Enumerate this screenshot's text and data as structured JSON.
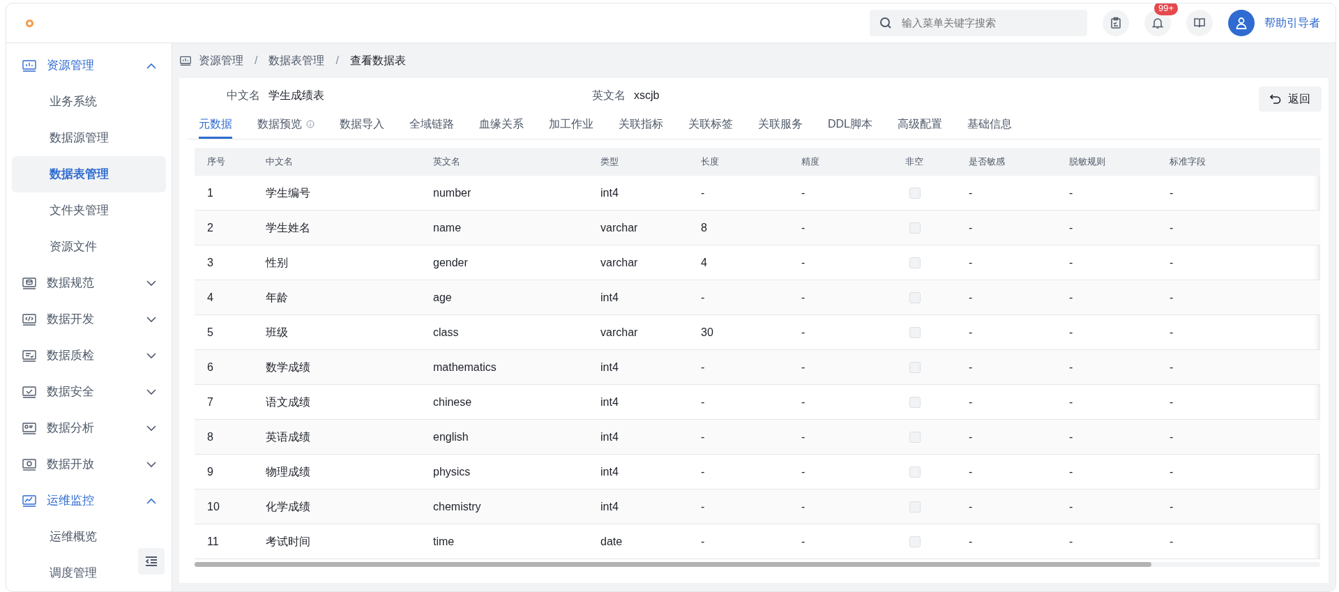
{
  "header": {
    "search": {
      "placeholder": "输入菜单关键字搜索"
    },
    "notification_badge": "99+",
    "user": "帮助引导者"
  },
  "sidebar": {
    "items": [
      {
        "label": "资源管理",
        "expanded": true,
        "children": [
          {
            "label": "业务系统",
            "selected": false
          },
          {
            "label": "数据源管理",
            "selected": false
          },
          {
            "label": "数据表管理",
            "selected": true
          },
          {
            "label": "文件夹管理",
            "selected": false
          },
          {
            "label": "资源文件",
            "selected": false
          }
        ]
      },
      {
        "label": "数据规范",
        "expanded": false
      },
      {
        "label": "数据开发",
        "expanded": false
      },
      {
        "label": "数据质检",
        "expanded": false
      },
      {
        "label": "数据安全",
        "expanded": false
      },
      {
        "label": "数据分析",
        "expanded": false
      },
      {
        "label": "数据开放",
        "expanded": false
      },
      {
        "label": "运维监控",
        "expanded": true,
        "children": [
          {
            "label": "运维概览",
            "selected": false
          },
          {
            "label": "调度管理",
            "selected": false
          }
        ]
      }
    ]
  },
  "breadcrumb": [
    {
      "kind": "link",
      "text": "资源管理"
    },
    {
      "kind": "separator",
      "text": "/"
    },
    {
      "kind": "link",
      "text": "数据表管理"
    },
    {
      "kind": "separator",
      "text": "/"
    },
    {
      "kind": "current",
      "text": "查看数据表"
    }
  ],
  "info": {
    "cn_label": "中文名",
    "cn_value": "学生成绩表",
    "en_label": "英文名",
    "en_value": "xscjb"
  },
  "back_button": "返回",
  "tabs": [
    {
      "label": "元数据",
      "selected": true
    },
    {
      "label": "数据预览",
      "selected": false,
      "info": true
    },
    {
      "label": "数据导入",
      "selected": false
    },
    {
      "label": "全域链路",
      "selected": false
    },
    {
      "label": "血缘关系",
      "selected": false
    },
    {
      "label": "加工作业",
      "selected": false
    },
    {
      "label": "关联指标",
      "selected": false
    },
    {
      "label": "关联标签",
      "selected": false
    },
    {
      "label": "关联服务",
      "selected": false
    },
    {
      "label": "DDL脚本",
      "selected": false
    },
    {
      "label": "高级配置",
      "selected": false
    },
    {
      "label": "基础信息",
      "selected": false
    }
  ],
  "table": {
    "columns": [
      "序号",
      "中文名",
      "英文名",
      "类型",
      "长度",
      "精度",
      "非空",
      "是否敏感",
      "脱敏规则",
      "标准字段"
    ],
    "rows": [
      {
        "cells": [
          "1",
          "学生编号",
          "number",
          "int4",
          "-",
          "-"
        ],
        "not_null": false,
        "rest": [
          "-",
          "-",
          "-"
        ]
      },
      {
        "cells": [
          "2",
          "学生姓名",
          "name",
          "varchar",
          "8",
          "-"
        ],
        "not_null": false,
        "rest": [
          "-",
          "-",
          "-"
        ]
      },
      {
        "cells": [
          "3",
          "性别",
          "gender",
          "varchar",
          "4",
          "-"
        ],
        "not_null": false,
        "rest": [
          "-",
          "-",
          "-"
        ]
      },
      {
        "cells": [
          "4",
          "年龄",
          "age",
          "int4",
          "-",
          "-"
        ],
        "not_null": false,
        "rest": [
          "-",
          "-",
          "-"
        ]
      },
      {
        "cells": [
          "5",
          "班级",
          "class",
          "varchar",
          "30",
          "-"
        ],
        "not_null": false,
        "rest": [
          "-",
          "-",
          "-"
        ]
      },
      {
        "cells": [
          "6",
          "数学成绩",
          "mathematics",
          "int4",
          "-",
          "-"
        ],
        "not_null": false,
        "rest": [
          "-",
          "-",
          "-"
        ]
      },
      {
        "cells": [
          "7",
          "语文成绩",
          "chinese",
          "int4",
          "-",
          "-"
        ],
        "not_null": false,
        "rest": [
          "-",
          "-",
          "-"
        ]
      },
      {
        "cells": [
          "8",
          "英语成绩",
          "english",
          "int4",
          "-",
          "-"
        ],
        "not_null": false,
        "rest": [
          "-",
          "-",
          "-"
        ]
      },
      {
        "cells": [
          "9",
          "物理成绩",
          "physics",
          "int4",
          "-",
          "-"
        ],
        "not_null": false,
        "rest": [
          "-",
          "-",
          "-"
        ]
      },
      {
        "cells": [
          "10",
          "化学成绩",
          "chemistry",
          "int4",
          "-",
          "-"
        ],
        "not_null": false,
        "rest": [
          "-",
          "-",
          "-"
        ]
      },
      {
        "cells": [
          "11",
          "考试时间",
          "time",
          "date",
          "-",
          "-"
        ],
        "not_null": false,
        "rest": [
          "-",
          "-",
          "-"
        ]
      }
    ]
  }
}
